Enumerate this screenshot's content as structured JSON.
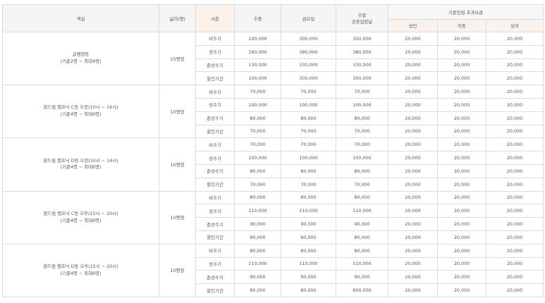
{
  "headers": {
    "room": "객실",
    "size": "넓이(평)",
    "season": "시즌",
    "weekday": "주중",
    "friday": "금요일",
    "weekend_line1": "주말",
    "weekend_line2": "공휴일전날",
    "extra_group": "기준인원 초과요금",
    "adult": "성인",
    "child": "아동",
    "infant": "유아"
  },
  "rooms": [
    {
      "name": "글램핑동",
      "capacity": "(기준2명 ~ 최대4명)",
      "size": "15평형",
      "rows": [
        {
          "season": "비수기",
          "weekday": "100,000",
          "friday": "300,000",
          "weekend": "300,000",
          "adult": "20,000",
          "child": "20,000",
          "infant": "20,000"
        },
        {
          "season": "성수기",
          "weekday": "180,000",
          "friday": "380,000",
          "weekend": "380,000",
          "adult": "20,000",
          "child": "20,000",
          "infant": "20,000"
        },
        {
          "season": "준성수기",
          "weekday": "130,000",
          "friday": "330,000",
          "weekend": "330,000",
          "adult": "20,000",
          "child": "20,000",
          "infant": "20,000"
        },
        {
          "season": "할인기간",
          "weekday": "100,000",
          "friday": "300,000",
          "weekend": "300,000",
          "adult": "20,000",
          "child": "20,000",
          "infant": "20,000"
        }
      ]
    },
    {
      "name": "꿈드림 캠프닉 C동 오전(10시 ~ 14시)",
      "capacity": "(기준4명 ~ 최대6명)",
      "size": "10평형",
      "rows": [
        {
          "season": "비수기",
          "weekday": "70,000",
          "friday": "70,000",
          "weekend": "70,000",
          "adult": "20,000",
          "child": "20,000",
          "infant": "20,000"
        },
        {
          "season": "성수기",
          "weekday": "100,000",
          "friday": "100,000",
          "weekend": "100,000",
          "adult": "20,000",
          "child": "20,000",
          "infant": "20,000"
        },
        {
          "season": "준성수기",
          "weekday": "80,000",
          "friday": "80,000",
          "weekend": "80,000",
          "adult": "20,000",
          "child": "20,000",
          "infant": "20,000"
        },
        {
          "season": "할인기간",
          "weekday": "70,000",
          "friday": "70,000",
          "weekend": "70,000",
          "adult": "20,000",
          "child": "20,000",
          "infant": "20,000"
        }
      ]
    },
    {
      "name": "꿈드림 캠프닉 D동 오전(10시 ~ 14시)",
      "capacity": "(기준4명 ~ 최대6명)",
      "size": "10평형",
      "rows": [
        {
          "season": "비수기",
          "weekday": "70,000",
          "friday": "70,000",
          "weekend": "70,000",
          "adult": "20,000",
          "child": "20,000",
          "infant": "20,000"
        },
        {
          "season": "성수기",
          "weekday": "100,000",
          "friday": "100,000",
          "weekend": "100,000",
          "adult": "20,000",
          "child": "20,000",
          "infant": "20,000"
        },
        {
          "season": "준성수기",
          "weekday": "80,000",
          "friday": "80,000",
          "weekend": "80,000",
          "adult": "20,000",
          "child": "20,000",
          "infant": "20,000"
        },
        {
          "season": "할인기간",
          "weekday": "70,000",
          "friday": "70,000",
          "weekend": "70,000",
          "adult": "20,000",
          "child": "20,000",
          "infant": "20,000"
        }
      ]
    },
    {
      "name": "꿈드림 캠프닉 C동 오후(15시 ~ 20시)",
      "capacity": "(기준4명 ~ 최대6명)",
      "size": "10평형",
      "rows": [
        {
          "season": "비수기",
          "weekday": "80,000",
          "friday": "80,000",
          "weekend": "80,000",
          "adult": "20,000",
          "child": "20,000",
          "infant": "20,000"
        },
        {
          "season": "성수기",
          "weekday": "110,000",
          "friday": "110,000",
          "weekend": "110,000",
          "adult": "20,000",
          "child": "20,000",
          "infant": "20,000"
        },
        {
          "season": "준성수기",
          "weekday": "90,000",
          "friday": "90,000",
          "weekend": "90,000",
          "adult": "20,000",
          "child": "20,000",
          "infant": "20,000"
        },
        {
          "season": "할인기간",
          "weekday": "80,000",
          "friday": "80,000",
          "weekend": "80,000",
          "adult": "20,000",
          "child": "20,000",
          "infant": "20,000"
        }
      ]
    },
    {
      "name": "꿈드림 캠프닉 D동 오후(15시 ~ 20시)",
      "capacity": "(기준4명 ~ 최대6명)",
      "size": "10평형",
      "rows": [
        {
          "season": "비수기",
          "weekday": "80,000",
          "friday": "80,000",
          "weekend": "80,000",
          "adult": "20,000",
          "child": "20,000",
          "infant": "20,000"
        },
        {
          "season": "성수기",
          "weekday": "110,000",
          "friday": "110,000",
          "weekend": "110,000",
          "adult": "20,000",
          "child": "20,000",
          "infant": "20,000"
        },
        {
          "season": "준성수기",
          "weekday": "90,000",
          "friday": "90,000",
          "weekend": "90,000",
          "adult": "20,000",
          "child": "20,000",
          "infant": "20,000"
        },
        {
          "season": "할인기간",
          "weekday": "80,000",
          "friday": "80,000",
          "weekend": "800,000",
          "adult": "20,000",
          "child": "20,000",
          "infant": "20,000"
        }
      ]
    }
  ]
}
